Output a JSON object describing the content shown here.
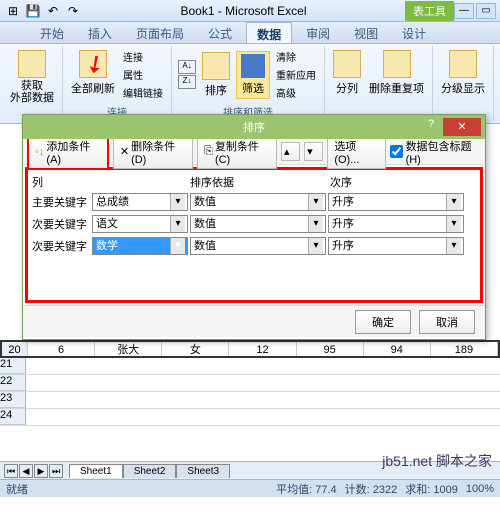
{
  "window": {
    "title": "Book1 - Microsoft Excel",
    "tools_tab": "表工具"
  },
  "tabs": [
    "开始",
    "插入",
    "页面布局",
    "公式",
    "数据",
    "审阅",
    "视图",
    "设计"
  ],
  "active_tab": "数据",
  "ribbon": {
    "get_data": "获取\n外部数据",
    "refresh": "全部刷新",
    "conn_group": {
      "connect": "连接",
      "props": "属性",
      "edit": "编辑链接",
      "label": "连接"
    },
    "sort": "排序",
    "filter": "筛选",
    "filter_group": {
      "clear": "清除",
      "reapply": "重新应用",
      "adv": "高级",
      "label": "排序和筛选"
    },
    "split": "分列",
    "dup": "删除重复项",
    "outline": "分级显示"
  },
  "dialog": {
    "title": "排序",
    "add": "添加条件(A)",
    "del": "删除条件(D)",
    "copy": "复制条件(C)",
    "opts": "选项(O)...",
    "headers": "数据包含标题(H)",
    "col_h": [
      "列",
      "排序依据",
      "次序"
    ],
    "rows": [
      {
        "label": "主要关键字",
        "field": "总成绩",
        "basis": "数值",
        "order": "升序"
      },
      {
        "label": "次要关键字",
        "field": "语文",
        "basis": "数值",
        "order": "升序"
      },
      {
        "label": "次要关键字",
        "field": "数学",
        "basis": "数值",
        "order": "升序"
      }
    ],
    "ok": "确定",
    "cancel": "取消"
  },
  "sheet_row": {
    "num": "20",
    "cells": [
      "6",
      "张大",
      "女",
      "12",
      "95",
      "94",
      "189"
    ]
  },
  "empty_rows": [
    "21",
    "22",
    "23",
    "24"
  ],
  "sheet_tabs": [
    "Sheet1",
    "Sheet2",
    "Sheet3"
  ],
  "status": {
    "ready": "就绪",
    "avg": "平均值: 77.4",
    "count": "计数: 2322",
    "sum": "求和: 1009",
    "zoom": "100%"
  },
  "watermark": "jb51.net 脚本之家"
}
